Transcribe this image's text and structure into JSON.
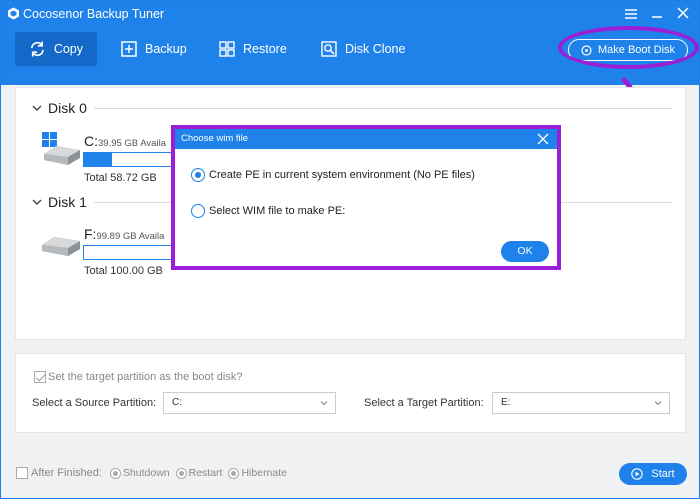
{
  "window": {
    "title": "Cocosenor Backup Tuner",
    "controls": [
      "menu-icon",
      "minimize-icon",
      "close-icon"
    ]
  },
  "toolbar": {
    "copy_label": "Copy",
    "backup_label": "Backup",
    "restore_label": "Restore",
    "disk_clone_label": "Disk Clone",
    "make_boot_disk_label": "Make Boot Disk"
  },
  "disks": [
    {
      "label": "Disk 0",
      "partition": {
        "letter": "C:",
        "available": "39.95 GB Availa",
        "total": "Total 58.72 GB",
        "used_fraction": 0.32,
        "icon": "windows-drive-icon"
      }
    },
    {
      "label": "Disk 1",
      "partition": {
        "letter": "F:",
        "available": "99.89 GB Availa",
        "total": "Total 100.00 GB",
        "used_fraction": 0.0,
        "icon": "drive-icon"
      }
    }
  ],
  "dialog": {
    "title": "Choose wim file",
    "option_create": "Create PE in current system environment (No PE files)",
    "option_select": "Select WIM file to make PE:",
    "selected_option": "create",
    "ok_label": "OK"
  },
  "target": {
    "boot_checkbox_label": "Set the target partition as the boot disk?",
    "boot_checked": true,
    "source_label": "Select a Source Partition:",
    "source_value": "C:",
    "target_label": "Select a Target Partition:",
    "target_value": "E:"
  },
  "footer": {
    "after_finished_label": "After Finished:",
    "options": [
      "Shutdown",
      "Restart",
      "Hibernate"
    ],
    "start_label": "Start"
  },
  "colors": {
    "accent": "#1e82ea",
    "highlight": "#9a1fd6",
    "background": "#f0f1f3"
  }
}
